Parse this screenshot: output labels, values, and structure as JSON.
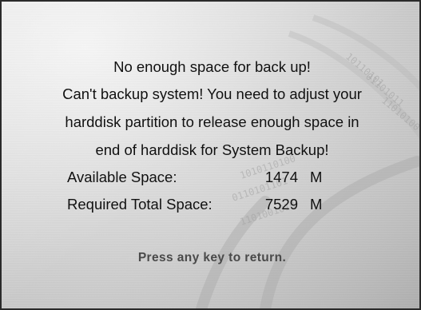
{
  "dialog": {
    "lines": [
      "No enough space for back up!",
      "Can't backup system! You need to adjust your",
      "harddisk partition to release enough space in",
      "end of harddisk for System Backup!"
    ],
    "available": {
      "label": "Available Space:",
      "value": "1474",
      "unit": "M"
    },
    "required": {
      "label": "Required Total Space:",
      "value": "7529",
      "unit": "M"
    },
    "prompt": "Press any key to return."
  }
}
